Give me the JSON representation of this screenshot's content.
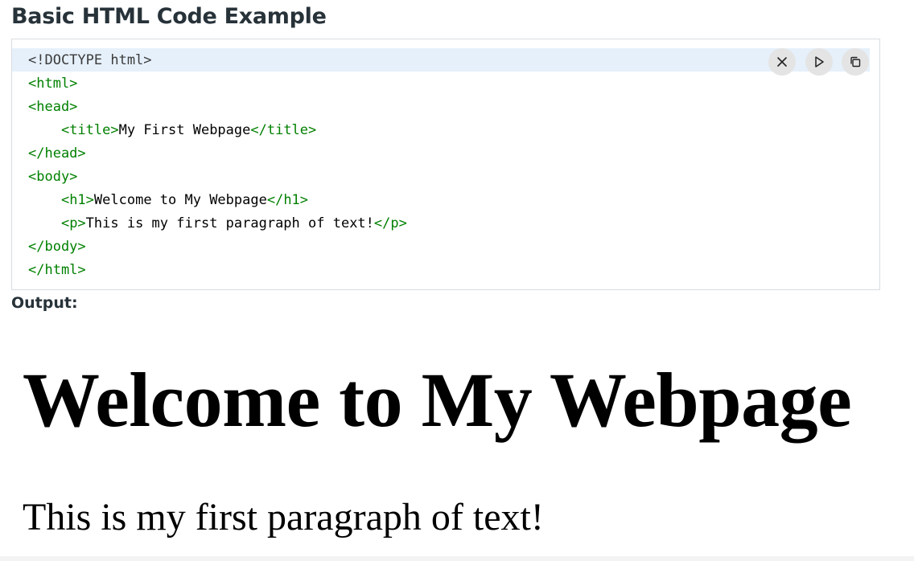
{
  "page": {
    "title": "Basic HTML Code Example",
    "output_label": "Output:"
  },
  "code": {
    "lines": [
      [
        {
          "t": "<!DOCTYPE html>",
          "k": "doctype"
        }
      ],
      [
        {
          "t": "<html>",
          "k": "tag"
        }
      ],
      [
        {
          "t": "<head>",
          "k": "tag"
        }
      ],
      [
        {
          "t": "    ",
          "k": "text"
        },
        {
          "t": "<title>",
          "k": "tag"
        },
        {
          "t": "My First Webpage",
          "k": "text"
        },
        {
          "t": "</title>",
          "k": "tag"
        }
      ],
      [
        {
          "t": "</head>",
          "k": "tag"
        }
      ],
      [
        {
          "t": "<body>",
          "k": "tag"
        }
      ],
      [
        {
          "t": "    ",
          "k": "text"
        },
        {
          "t": "<h1>",
          "k": "tag"
        },
        {
          "t": "Welcome to My Webpage",
          "k": "text"
        },
        {
          "t": "</h1>",
          "k": "tag"
        }
      ],
      [
        {
          "t": "    ",
          "k": "text"
        },
        {
          "t": "<p>",
          "k": "tag"
        },
        {
          "t": "This is my first paragraph of text!",
          "k": "text"
        },
        {
          "t": "</p>",
          "k": "tag"
        }
      ],
      [
        {
          "t": "</body>",
          "k": "tag"
        }
      ],
      [
        {
          "t": "</html>",
          "k": "tag"
        }
      ]
    ],
    "buttons": {
      "close_icon": "close-icon",
      "run_icon": "play-icon",
      "copy_icon": "copy-icon"
    }
  },
  "output": {
    "heading": "Welcome to My Webpage",
    "paragraph": "This is my first paragraph of text!"
  },
  "colors": {
    "tag": "#008000",
    "doctype": "#3b3b3b",
    "text": "#000000",
    "highlight": "#e6f0fb",
    "button_bg": "#e4e4e4"
  }
}
